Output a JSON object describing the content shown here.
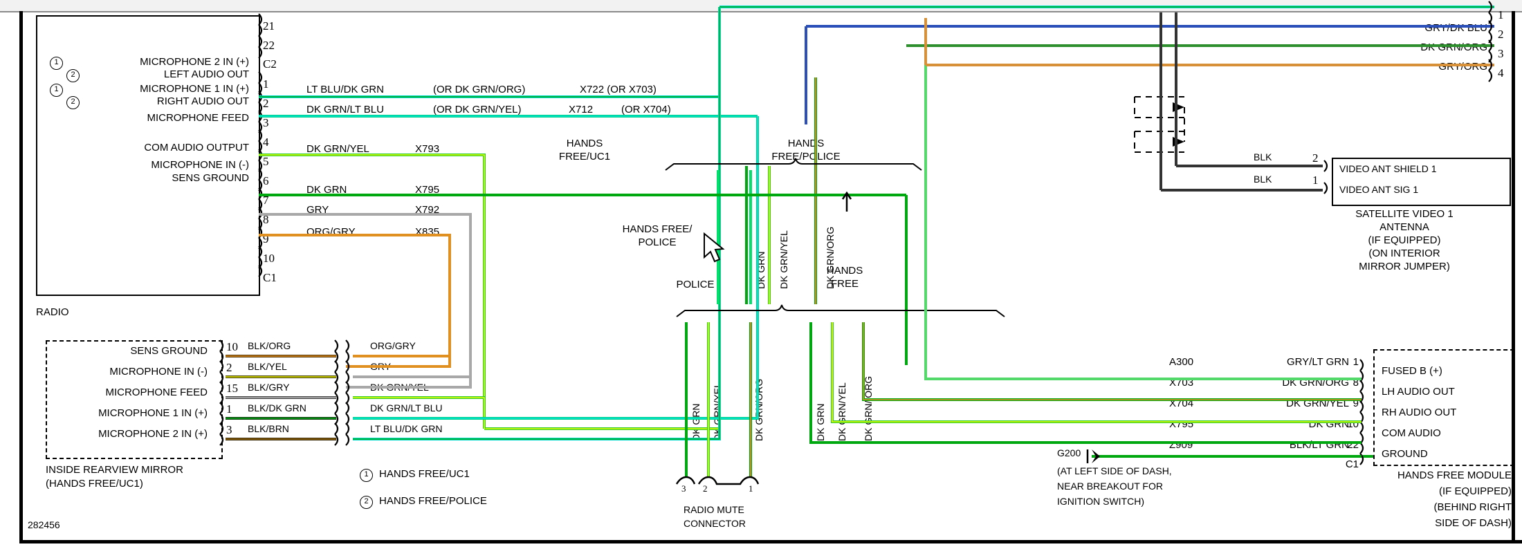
{
  "diagram": {
    "drawing_number": "282456",
    "radio": {
      "title": "RADIO",
      "connector_top": {
        "pins": [
          "21",
          "22"
        ],
        "label": "C2"
      },
      "connector_bottom": {
        "pins": [
          "1",
          "2",
          "3",
          "4",
          "5",
          "6",
          "7",
          "8",
          "9",
          "10"
        ],
        "label": "C1"
      },
      "pin_functions": [
        {
          "pin": "1",
          "names": [
            "MICROPHONE 2 IN (+)",
            "LEFT AUDIO OUT"
          ],
          "markers": [
            "1",
            "2"
          ]
        },
        {
          "pin": "2",
          "names": [
            "MICROPHONE 1 IN (+)",
            "RIGHT AUDIO OUT"
          ],
          "markers": [
            "1",
            "2"
          ]
        },
        {
          "pin": "4",
          "names": [
            "MICROPHONE FEED"
          ]
        },
        {
          "pin": "6",
          "names": [
            "COM AUDIO OUTPUT"
          ]
        },
        {
          "pin": "7",
          "names": [
            "MICROPHONE IN (-)"
          ]
        },
        {
          "pin": "8",
          "names": [
            "SENS GROUND"
          ]
        }
      ],
      "wires": [
        {
          "pin": "1",
          "color": "LT BLU/DK GRN",
          "alt": "(OR DK GRN/ORG)",
          "circuit": "X722 (OR X703)"
        },
        {
          "pin": "2",
          "color": "DK GRN/LT BLU",
          "alt": "(OR DK GRN/YEL)",
          "circuit": "X712",
          "circuit_alt": "(OR X704)"
        },
        {
          "pin": "4",
          "color": "DK GRN/YEL",
          "circuit": "X793"
        },
        {
          "pin": "6",
          "color": "DK GRN",
          "circuit": "X795"
        },
        {
          "pin": "7",
          "color": "GRY",
          "circuit": "X792"
        },
        {
          "pin": "8",
          "color": "ORG/GRY",
          "circuit": "X835"
        }
      ]
    },
    "mirror": {
      "title_line1": "INSIDE REARVIEW MIRROR",
      "title_line2": "(HANDS FREE/UC1)",
      "rows": [
        {
          "function": "SENS GROUND",
          "pin": "10",
          "color_left": "BLK/ORG",
          "color_right": "ORG/GRY"
        },
        {
          "function": "MICROPHONE IN (-)",
          "pin": "2",
          "color_left": "BLK/YEL",
          "color_right": "GRY"
        },
        {
          "function": "MICROPHONE FEED",
          "pin": "15",
          "color_left": "BLK/GRY",
          "color_right": "DK GRN/YEL"
        },
        {
          "function": "MICROPHONE 1 IN (+)",
          "pin": "1",
          "color_left": "BLK/DK GRN",
          "color_right": "DK GRN/LT BLU"
        },
        {
          "function": "MICROPHONE 2 IN (+)",
          "pin": "3",
          "color_left": "BLK/BRN",
          "color_right": "LT BLU/DK GRN"
        }
      ]
    },
    "legend": [
      {
        "marker": "1",
        "label": "HANDS FREE/UC1"
      },
      {
        "marker": "2",
        "label": "HANDS FREE/POLICE"
      }
    ],
    "center": {
      "bracket_upper_left_label": [
        "HANDS",
        "FREE/UC1"
      ],
      "bracket_upper_right_label": [
        "HANDS",
        "FREE/POLICE"
      ],
      "callout_hands_free_police": [
        "HANDS FREE/",
        "POLICE"
      ],
      "callout_police": "POLICE",
      "bracket_lower_left_label": "POLICE",
      "bracket_lower_right_label": [
        "HANDS",
        "FREE"
      ],
      "upper_wire_labels": [
        "DK GRN",
        "DK GRN/YEL",
        "DK GRN/ORG"
      ],
      "lower_wire_labels": [
        "DK GRN",
        "DK GRN/YEL",
        "DK GRN/ORG",
        "DK GRN",
        "DK GRN/YEL",
        "DK GRN/ ORG"
      ],
      "radio_mute": {
        "title_line1": "RADIO MUTE",
        "title_line2": "CONNECTOR",
        "pins": [
          "3",
          "2",
          "1"
        ]
      }
    },
    "satellite_antenna": {
      "box_rows": [
        "VIDEO ANT SHIELD 1",
        "VIDEO ANT SIG 1"
      ],
      "pins": [
        "2",
        "1"
      ],
      "wire_colors": [
        "BLK",
        "BLK"
      ],
      "caption": [
        "SATELLITE VIDEO 1",
        "ANTENNA",
        "(IF EQUIPPED)",
        "(ON INTERIOR",
        "MIRROR JUMPER)"
      ]
    },
    "top_right_bus": {
      "rows": [
        {
          "pin": "1",
          "color": ""
        },
        {
          "pin": "2",
          "color": "GRY/DK BLU"
        },
        {
          "pin": "3",
          "color": "DK GRN/ORG"
        },
        {
          "pin": "4",
          "color": "GRY/ORG"
        }
      ]
    },
    "ground": {
      "id": "G200",
      "notes": [
        "(AT LEFT SIDE OF DASH,",
        "NEAR BREAKOUT FOR",
        "IGNITION SWITCH)"
      ]
    },
    "hands_free_module": {
      "rows": [
        {
          "circuit": "A300",
          "color": "GRY/LT GRN",
          "pin": "1",
          "function": "FUSED B (+)"
        },
        {
          "circuit": "X703",
          "color": "DK GRN/ORG",
          "pin": "8",
          "function": "LH AUDIO OUT"
        },
        {
          "circuit": "X704",
          "color": "DK GRN/YEL",
          "pin": "9",
          "function": "RH AUDIO OUT"
        },
        {
          "circuit": "X795",
          "color": "DK GRN",
          "pin": "10",
          "function": "COM AUDIO"
        },
        {
          "circuit": "Z909",
          "color": "BLK/LT GRN",
          "pin": "22",
          "function": "GROUND"
        }
      ],
      "connector_label": "C1",
      "caption": [
        "HANDS FREE MODULE",
        "(IF EQUIPPED)",
        "(BEHIND RIGHT",
        "SIDE OF DASH)"
      ]
    },
    "colors": {
      "dk_grn": "#00a80f",
      "lt_grn": "#52d96a",
      "yel": "#ffff00",
      "org": "#e08a20",
      "gry": "#a8a8a8",
      "lt_blu": "#00e0d0",
      "dk_blu": "#2040b0",
      "blk": "#404040",
      "brn": "#8a5a10"
    }
  }
}
